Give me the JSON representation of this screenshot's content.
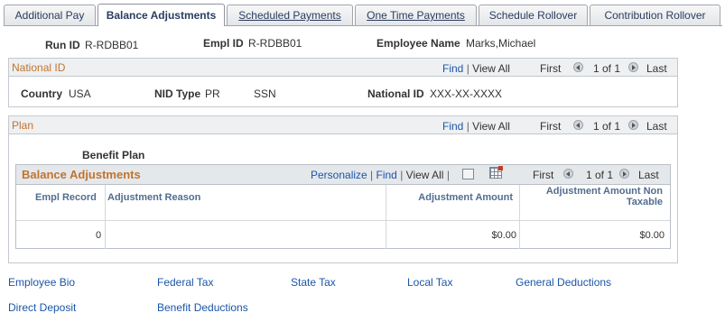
{
  "tabs": [
    {
      "label": "Additional Pay",
      "active": false
    },
    {
      "label": "Balance Adjustments",
      "active": true
    },
    {
      "label": "Scheduled Payments",
      "active": false
    },
    {
      "label": "One Time Payments",
      "active": false
    },
    {
      "label": "Schedule Rollover",
      "active": false
    },
    {
      "label": "Contribution Rollover",
      "active": false
    }
  ],
  "header": {
    "run_id_label": "Run ID",
    "run_id_value": "R-RDBB01",
    "empl_id_label": "Empl ID",
    "empl_id_value": "R-RDBB01",
    "employee_name_label": "Employee Name",
    "employee_name_value": "Marks,Michael"
  },
  "national_id": {
    "title": "National ID",
    "find": "Find",
    "sep": "|",
    "view_all": "View All",
    "first": "First",
    "range": "1 of 1",
    "last": "Last",
    "country_label": "Country",
    "country_value": "USA",
    "nid_type_label": "NID Type",
    "nid_type_value": "PR",
    "nid_type_desc": "SSN",
    "national_id_label": "National ID",
    "national_id_value": "XXX-XX-XXXX"
  },
  "plan": {
    "title": "Plan",
    "find": "Find",
    "sep": "|",
    "view_all": "View All",
    "first": "First",
    "range": "1 of 1",
    "last": "Last",
    "benefit_plan_label": "Benefit Plan"
  },
  "grid": {
    "title": "Balance Adjustments",
    "personalize": "Personalize",
    "sep": "|",
    "find": "Find",
    "view_all": "View All",
    "first": "First",
    "range": "1 of 1",
    "last": "Last",
    "columns": [
      "Empl Record",
      "Adjustment Reason",
      "Adjustment Amount",
      "Adjustment Amount Non",
      "Taxable"
    ],
    "row": {
      "empl_record": "0",
      "reason": "",
      "amount": "$0.00",
      "amount_non_taxable": "$0.00"
    }
  },
  "links": {
    "employee_bio": "Employee Bio",
    "federal_tax": "Federal Tax",
    "state_tax": "State Tax",
    "local_tax": "Local Tax",
    "general_deductions": "General Deductions",
    "direct_deposit": "Direct Deposit",
    "benefit_deductions": "Benefit Deductions"
  },
  "icons": {
    "nav_prev": "chevron-left-icon",
    "nav_next": "chevron-right-icon",
    "zoom": "new-window-icon",
    "download": "spreadsheet-icon"
  },
  "colors": {
    "section_title": "#c0742f",
    "link": "#1a56a8",
    "column_header": "#516d8f"
  }
}
